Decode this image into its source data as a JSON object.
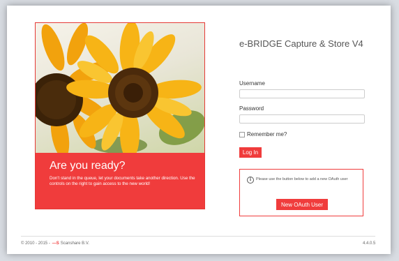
{
  "hero": {
    "title": "Are you ready?",
    "text": "Don't stand in the queue, let your documents take another direction. Use the controls on the right to gain access to the new world!"
  },
  "login": {
    "app_title": "e-BRIDGE Capture & Store V4",
    "username_label": "Username",
    "username_value": "",
    "password_label": "Password",
    "password_value": "",
    "remember_label": "Remember me?",
    "login_button": "Log In"
  },
  "oauth": {
    "info_icon": "i",
    "message": "Please use the button below to add a new OAuth user",
    "button": "New OAuth User"
  },
  "footer": {
    "copyright": "© 2010 - 2015 -",
    "logo_text": "—S",
    "company": "Scanshare B.V.",
    "version": "4.4.0.5"
  },
  "colors": {
    "accent": "#f03c3c"
  }
}
